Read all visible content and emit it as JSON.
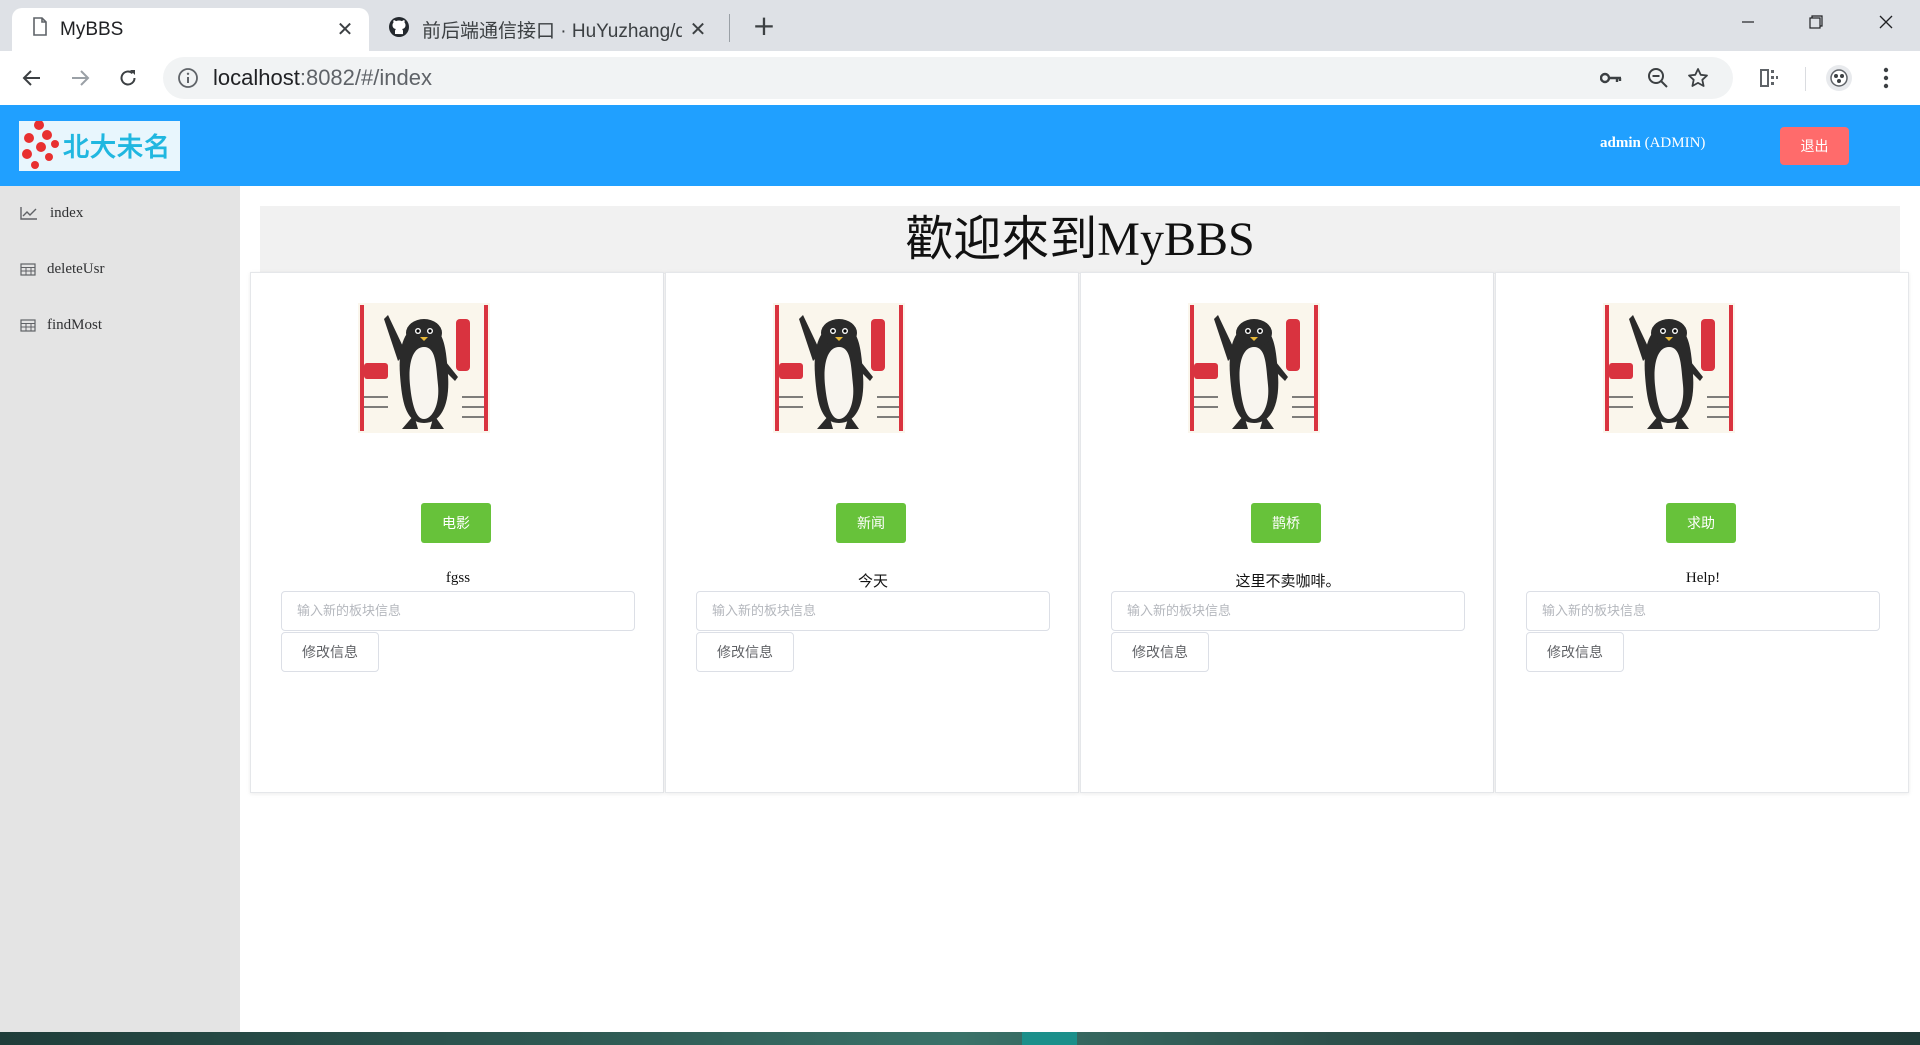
{
  "browser": {
    "tabs": [
      {
        "title": "MyBBS",
        "close": "✕"
      },
      {
        "title": "前后端通信接口 · HuYuzhang/d",
        "close": "✕"
      }
    ],
    "new_tab": "+",
    "url_host": "localhost",
    "url_rest": ":8082/#/index"
  },
  "header": {
    "logo_text": "北大未名",
    "user_name": "admin",
    "user_role": "(ADMIN)",
    "logout_label": "退出"
  },
  "sidebar": {
    "items": [
      {
        "label": "index",
        "icon": "line-chart-icon"
      },
      {
        "label": "deleteUsr",
        "icon": "table-icon"
      },
      {
        "label": "findMost",
        "icon": "table-icon"
      }
    ]
  },
  "main": {
    "welcome": "歡迎來到MyBBS",
    "boards": [
      {
        "button": "电影",
        "desc": "fgss",
        "placeholder": "输入新的板块信息",
        "modify": "修改信息"
      },
      {
        "button": "新闻",
        "desc": "今天",
        "placeholder": "输入新的板块信息",
        "modify": "修改信息"
      },
      {
        "button": "鹊桥",
        "desc": "这里不卖咖啡。",
        "placeholder": "输入新的板块信息",
        "modify": "修改信息"
      },
      {
        "button": "求助",
        "desc": "Help!",
        "placeholder": "输入新的板块信息",
        "modify": "修改信息"
      }
    ]
  },
  "colors": {
    "header_bg": "#20a0ff",
    "logout_bg": "#ff6b6b",
    "board_button_bg": "#67c23a",
    "sidebar_bg": "#e4e4e4"
  }
}
